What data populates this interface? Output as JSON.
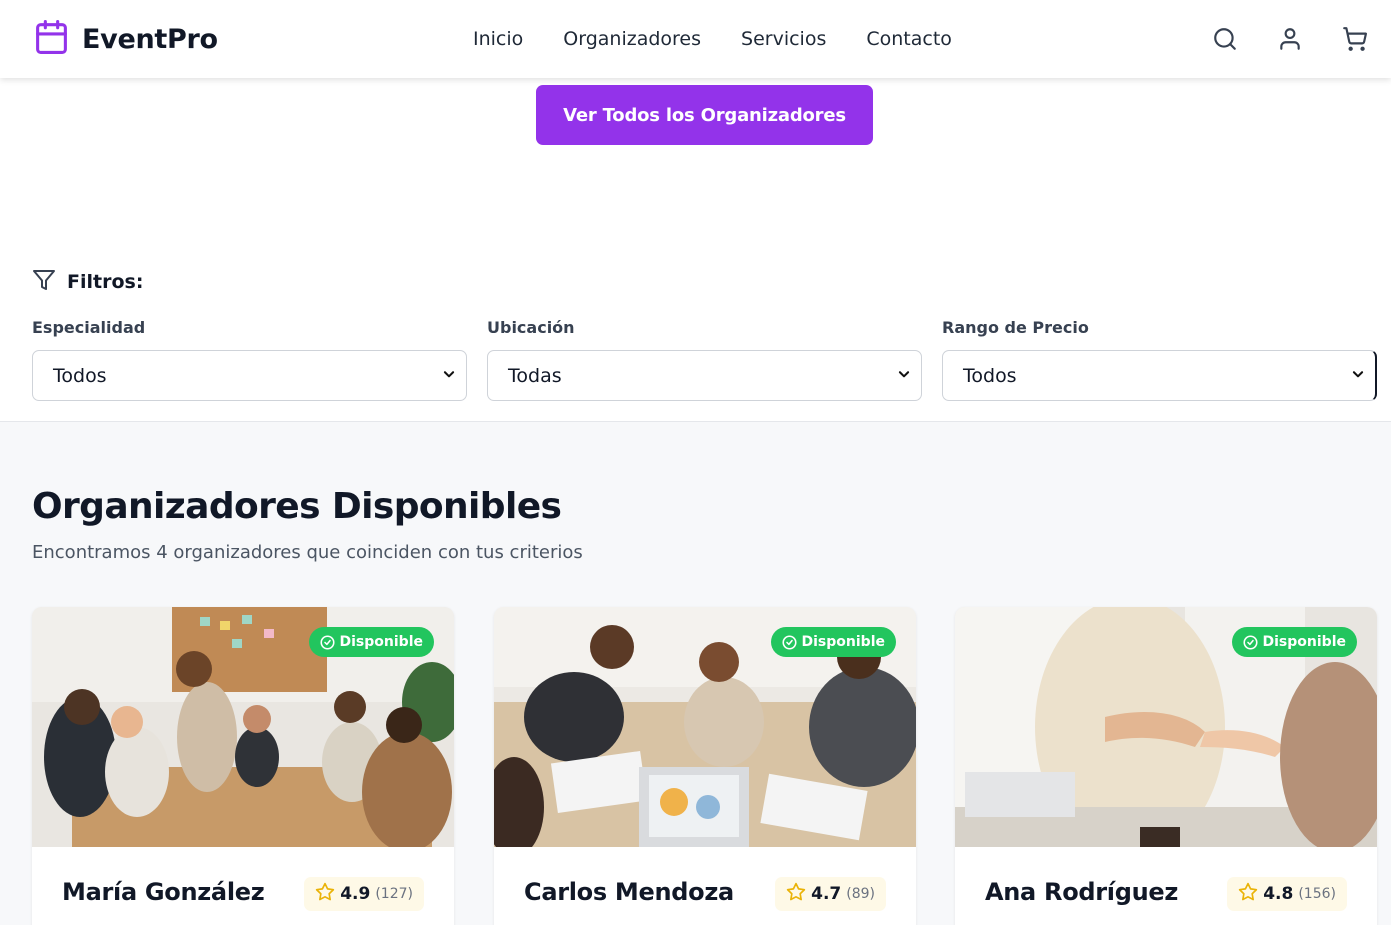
{
  "header": {
    "brand": "EventPro",
    "nav": [
      "Inicio",
      "Organizadores",
      "Servicios",
      "Contacto"
    ],
    "icons": [
      "search-icon",
      "user-icon",
      "cart-icon"
    ]
  },
  "cta": {
    "label": "Ver Todos los Organizadores"
  },
  "filters": {
    "title": "Filtros:",
    "groups": [
      {
        "label": "Especialidad",
        "value": "Todos"
      },
      {
        "label": "Ubicación",
        "value": "Todas"
      },
      {
        "label": "Rango de Precio",
        "value": "Todos"
      }
    ]
  },
  "results": {
    "title": "Organizadores Disponibles",
    "subtitle": "Encontramos 4 organizadores que coinciden con tus criterios",
    "cards": [
      {
        "name": "María González",
        "badge": "Disponible",
        "rating": "4.9",
        "reviews": "(127)"
      },
      {
        "name": "Carlos Mendoza",
        "badge": "Disponible",
        "rating": "4.7",
        "reviews": "(89)"
      },
      {
        "name": "Ana Rodríguez",
        "badge": "Disponible",
        "rating": "4.8",
        "reviews": "(156)"
      }
    ]
  },
  "colors": {
    "accent": "#9333ea",
    "badge": "#22c55e",
    "star": "#eab308",
    "section_bg": "#f7f8fa"
  }
}
